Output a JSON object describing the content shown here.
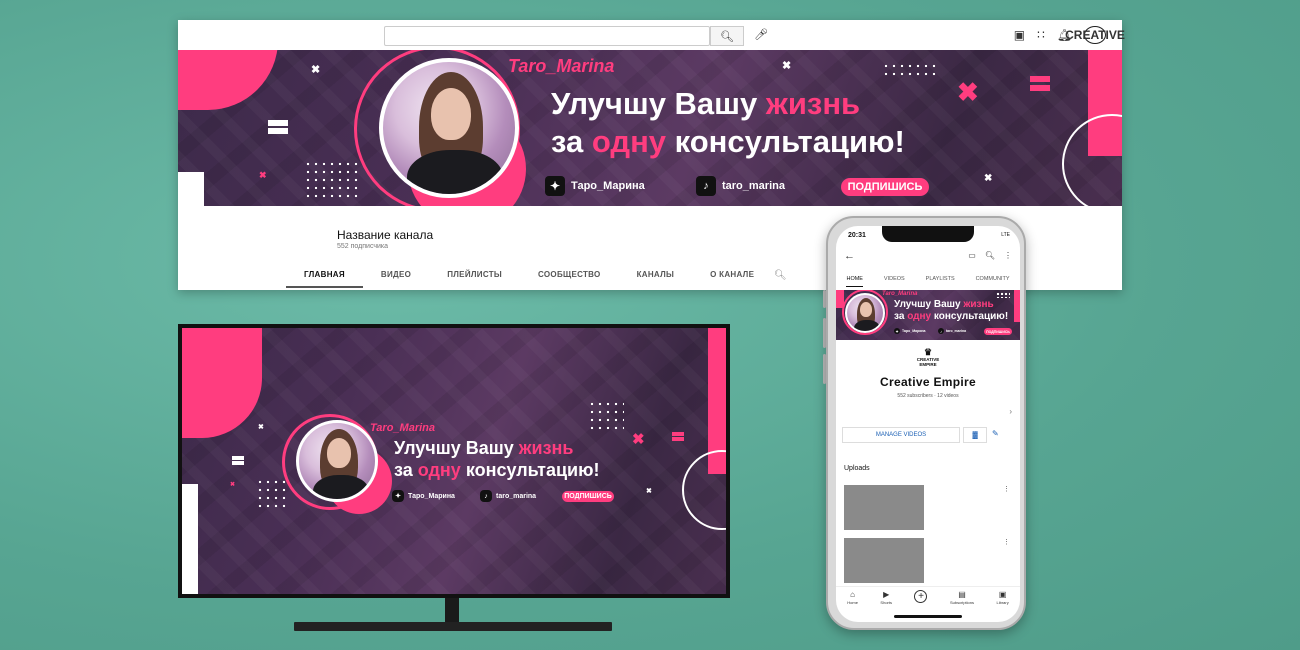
{
  "desktop": {
    "channel_name": "Название канала",
    "subscribers": "552 подписчика",
    "tabs": [
      "ГЛАВНАЯ",
      "ВИДЕО",
      "ПЛЕЙЛИСТЫ",
      "СООБЩЕСТВО",
      "КАНАЛЫ",
      "О КАНАЛЕ"
    ],
    "active_tab": 0
  },
  "banner": {
    "name": "Taro_Marina",
    "line1_a": "Улучшу Вашу ",
    "line1_hl": "жизнь",
    "line2_a": "за ",
    "line2_hl": "одну",
    "line2_b": " консультацию!",
    "social_1": "Таро_Марина",
    "social_2": "taro_marina",
    "subscribe": "ПОДПИШИСЬ"
  },
  "logo": {
    "line1": "CREATIVE",
    "line2": "EMPIRE"
  },
  "phone": {
    "time": "20:31",
    "status": "LTE",
    "tabs": [
      "HOME",
      "VIDEOS",
      "PLAYLISTS",
      "COMMUNITY"
    ],
    "channel": "Creative Empire",
    "meta": "552 subscribers · 12 videos",
    "manage": "MANAGE VIDEOS",
    "uploads": "Uploads",
    "nav": [
      "Home",
      "Shorts",
      "",
      "Subscriptions",
      "Library"
    ]
  },
  "colors": {
    "accent": "#ff3d7f",
    "background": "#5fae9c",
    "banner": "#4a2f55"
  },
  "icons": {
    "search": "search-icon",
    "mic": "mic-icon",
    "create": "video-create-icon",
    "apps": "apps-grid-icon",
    "bell": "bell-icon",
    "cast": "cast-icon",
    "more": "more-vert-icon"
  }
}
